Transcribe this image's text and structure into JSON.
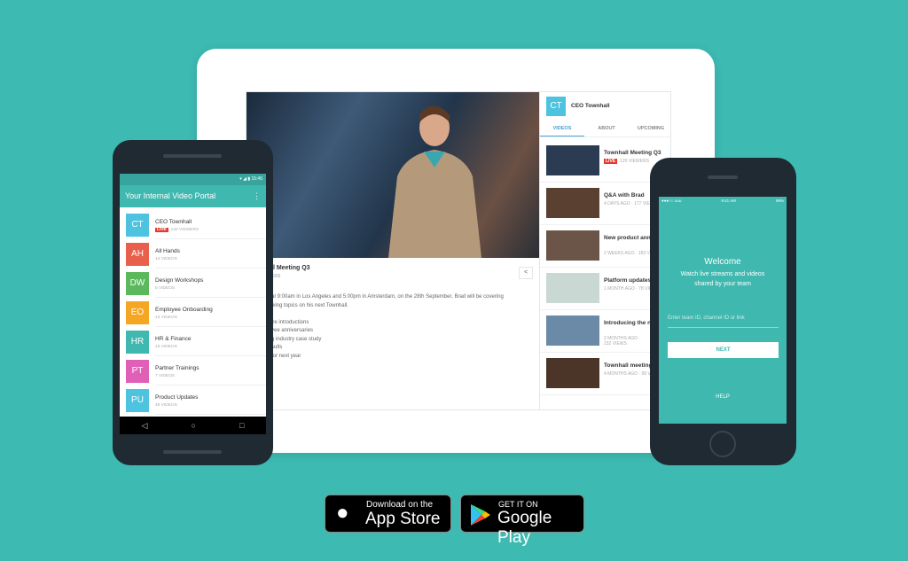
{
  "colors": {
    "background": "#3dbab2",
    "teal": "#3fb8af",
    "live": "#e8372e",
    "tab_active": "#4a9fd8"
  },
  "tablet": {
    "video_title": "ll Meeting Q3",
    "video_sub": "ERS",
    "share_icon": "share-icon",
    "description": [
      "at 9:00am in Los Angeles and 5:00pm in Amsterdam, on the 28th September, Brad will be covering",
      "wing topics on his next Townhall.",
      "",
      "ire introductions",
      "yee anniversaries",
      "g industry case study",
      "sults",
      "for next year"
    ],
    "channel": {
      "initials": "CT",
      "name": "CEO Townhall"
    },
    "tabs": [
      {
        "label": "VIDEOS",
        "active": true
      },
      {
        "label": "ABOUT"
      },
      {
        "label": "UPCOMING"
      }
    ],
    "videos": [
      {
        "title": "Townhall Meeting Q3",
        "live": "LIVE",
        "meta": "120 VIEWERS"
      },
      {
        "title": "Q&A with Brad",
        "meta": "4 DAYS AGO · 177 VIEWS"
      },
      {
        "title": "New product announcement",
        "meta": "2 WEEKS AGO · 183 VIEWS"
      },
      {
        "title": "Platform updates",
        "meta": "1 MONTH AGO · 78 VIEWS"
      },
      {
        "title": "Introducing the new acquisitions for...",
        "meta": "2 MONTHS AGO ·",
        "meta2": "232 VIEWS"
      },
      {
        "title": "Townhall meeting",
        "meta": "4 MONTHS AGO · 99 VIEWS"
      }
    ]
  },
  "android": {
    "time": "15:45",
    "title": "Your Internal Video Portal",
    "channels": [
      {
        "initials": "CT",
        "name": "CEO Townhall",
        "live": "LIVE",
        "count": "120 VIEWERS",
        "color": "#4ec3e0"
      },
      {
        "initials": "AH",
        "name": "All Hands",
        "count": "14 VIDEOS",
        "color": "#e8604c"
      },
      {
        "initials": "DW",
        "name": "Design Workshops",
        "count": "5 VIDEOS",
        "color": "#5cb85c"
      },
      {
        "initials": "EO",
        "name": "Employee Onboarding",
        "count": "13 VIDEOS",
        "color": "#f5a623"
      },
      {
        "initials": "HR",
        "name": "HR & Finance",
        "count": "13 VIDEOS",
        "color": "#3fb8af"
      },
      {
        "initials": "PT",
        "name": "Partner Trainings",
        "count": "7 VIDEOS",
        "color": "#e060b8"
      },
      {
        "initials": "PU",
        "name": "Product Updates",
        "count": "48 VIDEOS",
        "color": "#4ec3e0"
      }
    ],
    "nav": [
      "◁",
      "○",
      "□"
    ]
  },
  "iphone": {
    "carrier": "●●●○○ uuu",
    "time": "9:41 AM",
    "battery": "99%",
    "welcome": "Welcome",
    "subtitle1": "Watch live streams and videos",
    "subtitle2": "shared by your team",
    "input_placeholder": "Enter team ID, channel ID or link",
    "next": "NEXT",
    "help": "HELP"
  },
  "badges": {
    "appstore_top": "Download on the",
    "appstore_main": "App Store",
    "gplay_top": "GET IT ON",
    "gplay_main": "Google Play"
  }
}
